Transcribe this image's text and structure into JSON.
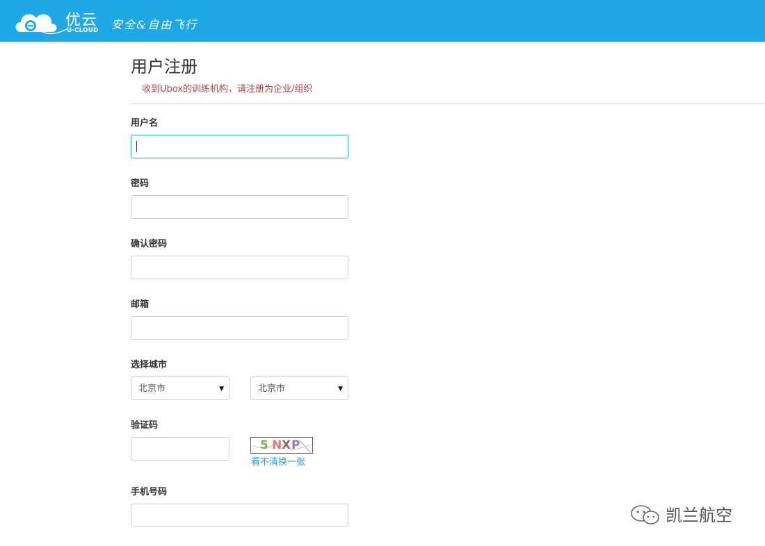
{
  "header": {
    "logo_cn": "优云",
    "logo_en": "U-CLOUD",
    "slogan": "安全&自由飞行",
    "bg_color": "#1fa8e6"
  },
  "form": {
    "title": "用户注册",
    "notice": "收到Ubox的训练机构，请注册为企业/组织",
    "username_label": "用户名",
    "username_value": "",
    "password_label": "密码",
    "confirm_password_label": "确认密码",
    "email_label": "邮箱",
    "city_label": "选择城市",
    "province_selected": "北京市",
    "city_selected": "北京市",
    "captcha_label": "验证码",
    "captcha_chars": [
      "5",
      "N",
      "X",
      "P"
    ],
    "captcha_refresh": "看不清换一张",
    "phone_label": "手机号码"
  },
  "watermark": {
    "text": "凯兰航空",
    "icon": "wechat-icon"
  }
}
